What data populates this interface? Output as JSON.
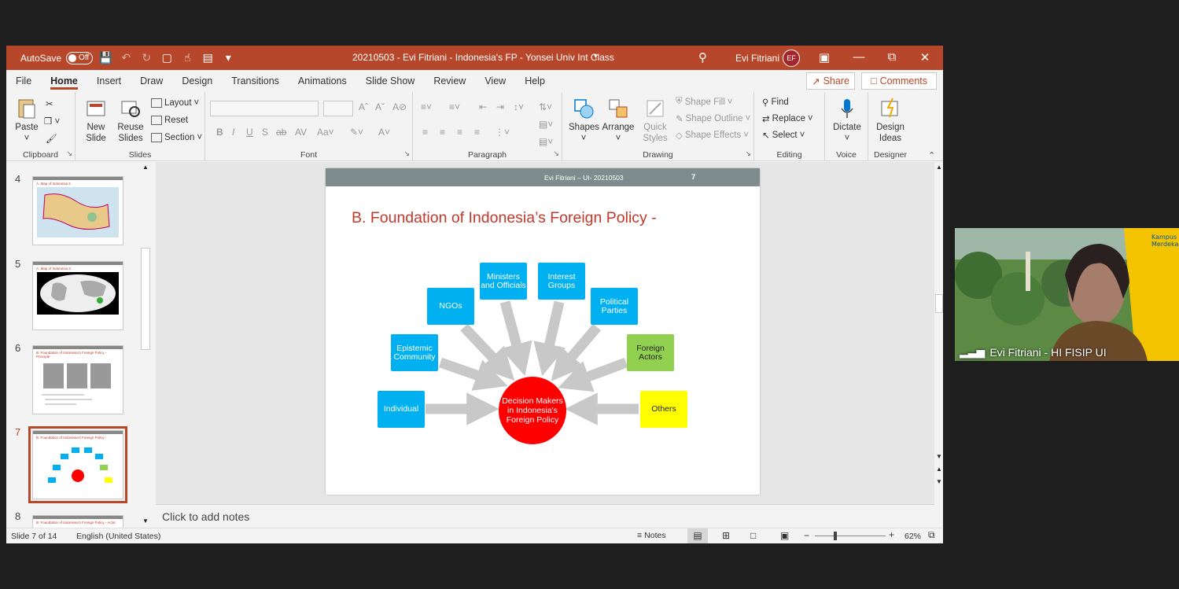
{
  "window": {
    "autosave_label": "AutoSave",
    "autosave_state": "Off",
    "doc_title": "20210503 - Evi Fitriani - Indonesia's FP - Yonsei Univ Int Class",
    "user_name": "Evi Fitriani",
    "user_initials": "EF"
  },
  "tabs": [
    "File",
    "Home",
    "Insert",
    "Draw",
    "Design",
    "Transitions",
    "Animations",
    "Slide Show",
    "Review",
    "View",
    "Help"
  ],
  "share_label": "Share",
  "comments_label": "Comments",
  "ribbon": {
    "clipboard": {
      "paste": "Paste",
      "label": "Clipboard"
    },
    "slides": {
      "new_slide": "New Slide",
      "reuse_slides": "Reuse Slides",
      "layout": "Layout",
      "reset": "Reset",
      "section": "Section",
      "label": "Slides"
    },
    "font": {
      "label": "Font"
    },
    "paragraph": {
      "label": "Paragraph"
    },
    "drawing": {
      "shapes": "Shapes",
      "arrange": "Arrange",
      "quick_styles": "Quick Styles",
      "shape_fill": "Shape Fill",
      "shape_outline": "Shape Outline",
      "shape_effects": "Shape Effects",
      "label": "Drawing"
    },
    "editing": {
      "find": "Find",
      "replace": "Replace",
      "select": "Select",
      "label": "Editing"
    },
    "voice": {
      "dictate": "Dictate",
      "label": "Voice"
    },
    "designer": {
      "design_ideas": "Design Ideas",
      "label": "Designer"
    }
  },
  "thumbnails": [
    {
      "num": "4",
      "title": "A. Map of Indonesia 2"
    },
    {
      "num": "5",
      "title": "A. Map of Indonesia 3"
    },
    {
      "num": "6",
      "title": "B. Foundation of Indonesia's Foreign Policy - Principle"
    },
    {
      "num": "7",
      "title": "B. Foundation of Indonesia's Foreign Policy -"
    },
    {
      "num": "8",
      "title": "B. Foundation of Indonesia's Foreign Policy - Actor"
    }
  ],
  "slide": {
    "header_text": "Evi Fitriani – UI- 20210503",
    "number": "7",
    "title": "B. Foundation of Indonesia’s Foreign Policy -",
    "center": "Decision Makers in Indonesia's Foreign Policy",
    "nodes": {
      "individual": "Individual",
      "epistemic": "Epistemic Community",
      "ngos": "NGOs",
      "ministers": "Ministers and Officials",
      "interest": "Interest Groups",
      "political": "Political Parties",
      "foreign": "Foreign Actors",
      "others": "Others"
    }
  },
  "notes_placeholder": "Click to add notes",
  "status": {
    "slide_count": "Slide 7 of 14",
    "language": "English (United States)",
    "notes": "Notes",
    "zoom": "62%"
  },
  "video": {
    "participant": "Evi Fitriani - HI FISIP UI"
  },
  "colors": {
    "accent": "#b7472a",
    "node_blue": "#00b0f0",
    "node_green": "#92d050",
    "node_yellow": "#ffff00",
    "center_red": "#ff0000"
  }
}
